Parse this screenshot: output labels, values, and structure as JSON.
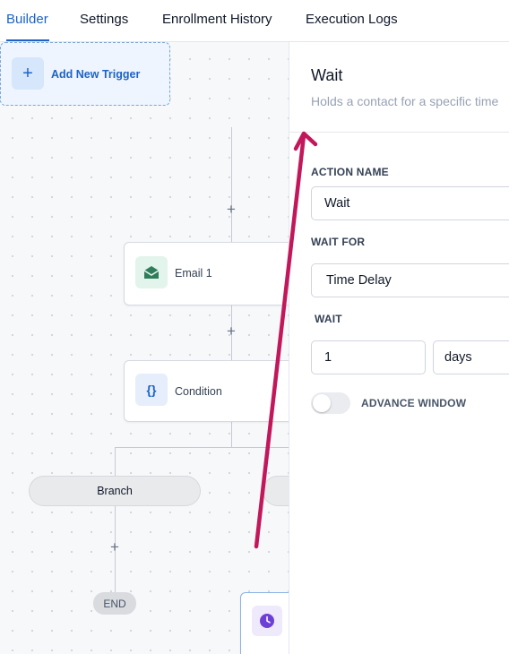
{
  "tabs": [
    {
      "label": "Builder",
      "active": true
    },
    {
      "label": "Settings"
    },
    {
      "label": "Enrollment History"
    },
    {
      "label": "Execution Logs"
    }
  ],
  "workflow": {
    "trigger_label": "Add New Trigger",
    "nodes": [
      {
        "label": "Email 1",
        "icon": "email-open-icon"
      },
      {
        "label": "Condition",
        "icon": "braces-icon"
      }
    ],
    "branch_label": "Branch",
    "end_label": "END",
    "wait_node_icon": "clock-icon"
  },
  "panel": {
    "title": "Wait",
    "subtitle": "Holds a contact for a specific time",
    "action_name_label": "ACTION NAME",
    "action_name_value": "Wait",
    "wait_for_label": "WAIT FOR",
    "wait_for_value": "Time Delay",
    "wait_label": "WAIT",
    "wait_amount": "1",
    "wait_unit": "days",
    "advance_window_label": "ADVANCE WINDOW",
    "advance_window_enabled": false
  },
  "colors": {
    "accent": "#1d63c8",
    "annotation_arrow": "#c2185b",
    "email_icon": "#2f7d5b",
    "wait_icon": "#6d3fd6"
  }
}
